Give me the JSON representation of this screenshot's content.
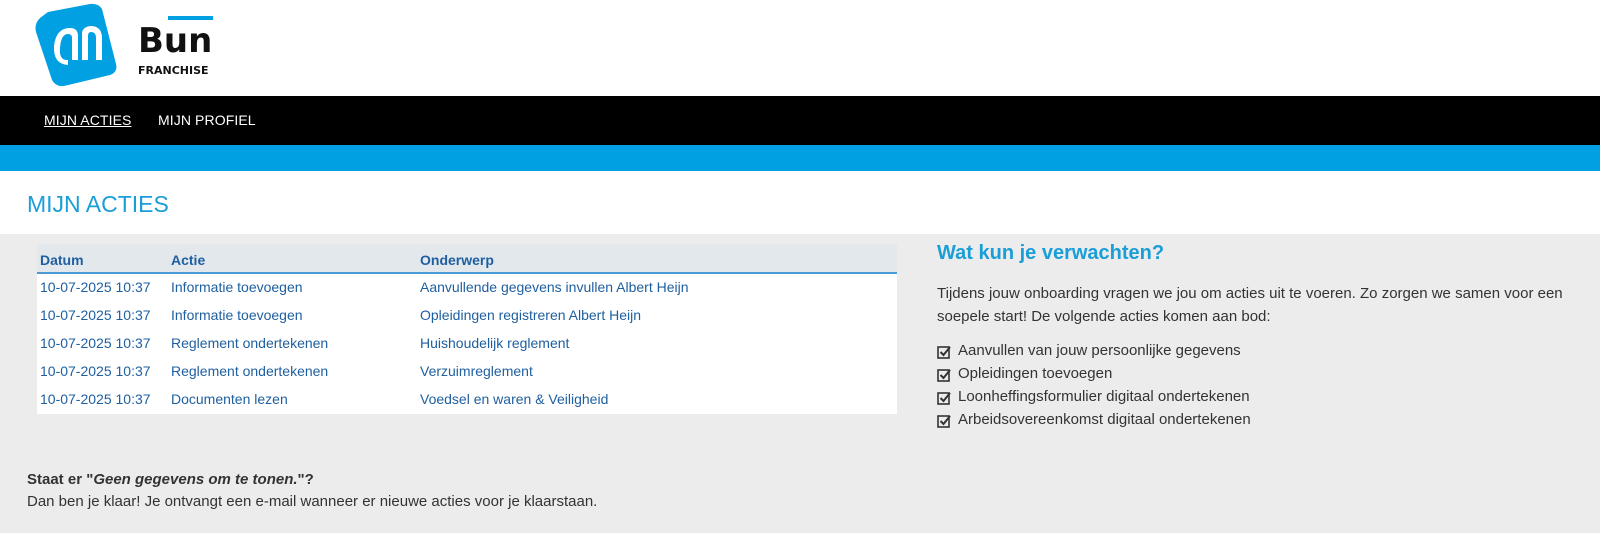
{
  "brand": {
    "logo_ah": "ah-logo",
    "logo_bun_text": "Bun",
    "logo_bun_sub": "FRANCHISE",
    "accent_blue": "#00a0e2",
    "title_blue": "#1a9ed8",
    "link_blue": "#1f5fa0"
  },
  "nav": {
    "items": [
      {
        "label": "MIJN ACTIES",
        "active": true
      },
      {
        "label": "MIJN PROFIEL",
        "active": false
      }
    ]
  },
  "page": {
    "title": "MIJN ACTIES"
  },
  "table": {
    "columns": [
      "Datum",
      "Actie",
      "Onderwerp"
    ],
    "rows": [
      [
        "10-07-2025 10:37",
        "Informatie toevoegen",
        "Aanvullende gegevens invullen Albert Heijn"
      ],
      [
        "10-07-2025 10:37",
        "Informatie toevoegen",
        "Opleidingen registreren Albert Heijn"
      ],
      [
        "10-07-2025 10:37",
        "Reglement ondertekenen",
        "Huishoudelijk reglement"
      ],
      [
        "10-07-2025 10:37",
        "Reglement ondertekenen",
        "Verzuimreglement"
      ],
      [
        "10-07-2025 10:37",
        "Documenten lezen",
        "Voedsel en waren & Veiligheid"
      ]
    ]
  },
  "side": {
    "title": "Wat kun je verwachten?",
    "intro": "Tijdens jouw onboarding vragen we jou om acties uit te voeren. Zo zorgen we samen voor een soepele start! De volgende acties komen aan bod:",
    "items": [
      "Aanvullen van jouw persoonlijke gegevens",
      "Opleidingen toevoegen",
      "Loonheffingsformulier digitaal ondertekenen",
      "Arbeidsovereenkomst digitaal ondertekenen"
    ]
  },
  "note": {
    "prefix": "Staat er \"",
    "emph": "Geen gegevens om te tonen.",
    "suffix": "\"?",
    "line2": "Dan ben je klaar! Je ontvangt een e-mail wanneer er nieuwe acties voor je klaarstaan."
  }
}
